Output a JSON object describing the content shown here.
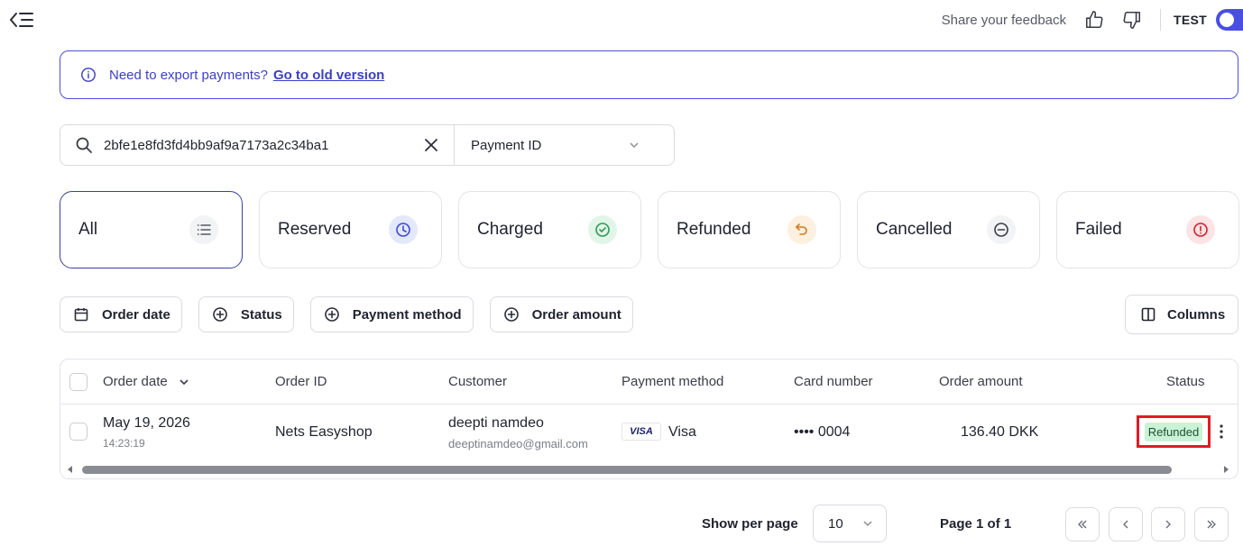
{
  "topbar": {
    "feedback_text": "Share your feedback",
    "test_label": "TEST",
    "accent_color": "#4a4fe0"
  },
  "banner": {
    "text": "Need to export payments?",
    "link_text": "Go to old version"
  },
  "search": {
    "value": "2bfe1e8fd3fd4bb9af9a7173a2c34ba1",
    "field_select": "Payment ID"
  },
  "tabs": [
    {
      "label": "All",
      "icon": "list-icon"
    },
    {
      "label": "Reserved",
      "icon": "clock-icon"
    },
    {
      "label": "Charged",
      "icon": "check-circle-icon"
    },
    {
      "label": "Refunded",
      "icon": "undo-icon"
    },
    {
      "label": "Cancelled",
      "icon": "minus-circle-icon"
    },
    {
      "label": "Failed",
      "icon": "alert-circle-icon"
    }
  ],
  "filters": {
    "order_date": "Order date",
    "status": "Status",
    "payment_method": "Payment method",
    "order_amount": "Order amount",
    "columns": "Columns"
  },
  "table": {
    "headers": {
      "order_date": "Order date",
      "order_id": "Order ID",
      "customer": "Customer",
      "payment_method": "Payment method",
      "card_number": "Card number",
      "order_amount": "Order amount",
      "status": "Status"
    },
    "rows": [
      {
        "date": "May 19, 2026",
        "time": "14:23:19",
        "order_id": "Nets Easyshop",
        "customer_name": "deepti namdeo",
        "customer_email": "deeptinamdeo@gmail.com",
        "card_brand": "VISA",
        "payment_method": "Visa",
        "card_number": "•••• 0004",
        "order_amount": "136.40 DKK",
        "status": "Refunded"
      }
    ]
  },
  "pagination": {
    "show_per_page_label": "Show per page",
    "per_page": "10",
    "page_label": "Page 1 of 1"
  }
}
